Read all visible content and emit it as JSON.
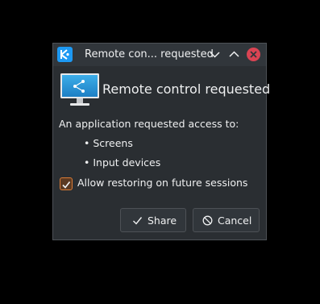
{
  "window": {
    "title": "Remote con... requested",
    "app_icon": "kde-logo-icon",
    "controls": [
      "chevron-down-icon",
      "chevron-up-icon",
      "close-icon"
    ]
  },
  "dialog": {
    "header_icon": "monitor-share-icon",
    "heading": "Remote control requested",
    "intro": "An application requested access to:",
    "items": [
      "• Screens",
      "• Input devices"
    ],
    "checkbox": {
      "label": "Allow restoring on future sessions",
      "checked": true
    }
  },
  "buttons": {
    "share": {
      "label": "Share",
      "icon": "checkmark-icon"
    },
    "cancel": {
      "label": "Cancel",
      "icon": "cancel-icon"
    }
  },
  "colors": {
    "accent": "#1d99f3",
    "close": "#da4453",
    "checkbox": "#da7b35",
    "window_bg": "#2a2e32",
    "titlebar_bg": "#31363b",
    "text": "#eff0f1"
  }
}
